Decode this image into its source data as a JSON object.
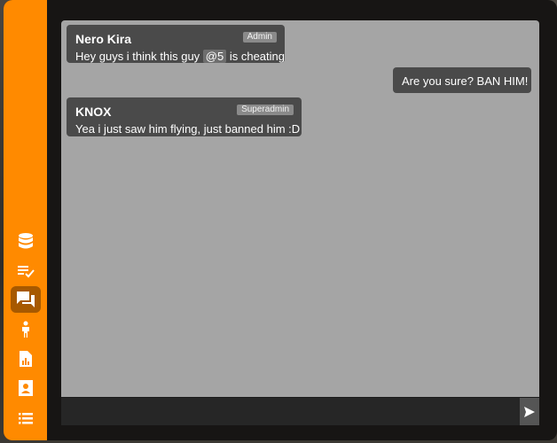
{
  "sidebar": {
    "items": [
      {
        "icon": "database-icon"
      },
      {
        "icon": "checklist-icon"
      },
      {
        "icon": "chat-icon",
        "active": true
      },
      {
        "icon": "person-icon"
      },
      {
        "icon": "report-icon"
      },
      {
        "icon": "contact-card-icon"
      },
      {
        "icon": "list-icon"
      }
    ],
    "accent": "#ff8a00",
    "active_bg": "#a75900"
  },
  "chat": {
    "messages": [
      {
        "author": "Nero Kira",
        "role": "Admin",
        "text_before": "Hey guys i think this guy ",
        "mention": "@5",
        "text_after": " is cheating"
      },
      {
        "text": "Are you sure? BAN HIM!",
        "own": true
      },
      {
        "author": "KNOX",
        "role": "Superadmin",
        "text": "Yea i just saw him flying, just banned him :D"
      }
    ],
    "input": {
      "value": "",
      "placeholder": ""
    },
    "send_icon": "send-icon"
  }
}
